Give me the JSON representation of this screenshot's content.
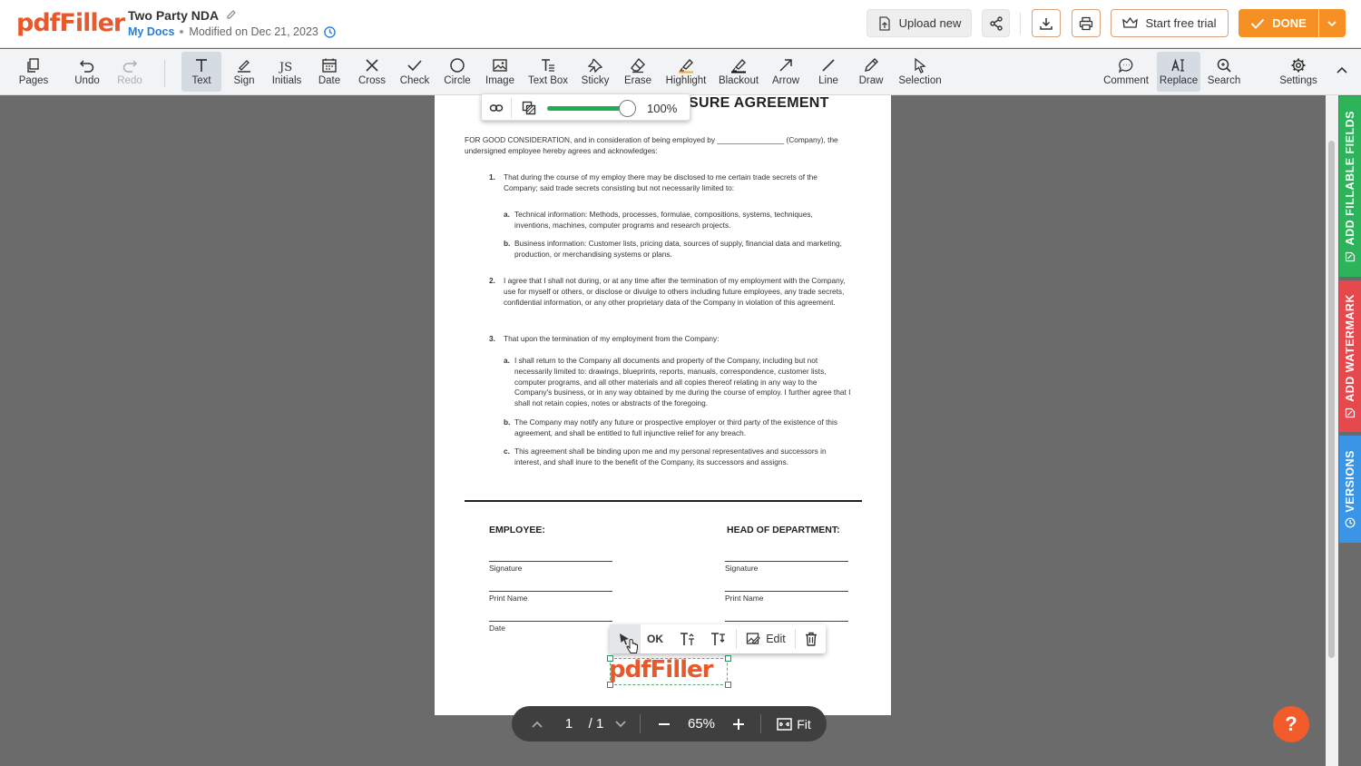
{
  "header": {
    "logo": "pdfFiller",
    "doc_title": "Two Party NDA",
    "breadcrumb": "My Docs",
    "modified": "Modified on Dec 21, 2023",
    "upload_label": "Upload new",
    "trial_label": "Start free trial",
    "done_label": "DONE"
  },
  "toolbar": {
    "tools": [
      {
        "label": "Pages",
        "icon": "pages-icon"
      },
      {
        "label": "Undo",
        "icon": "undo-icon"
      },
      {
        "label": "Redo",
        "icon": "redo-icon"
      },
      {
        "label": "Text",
        "icon": "text-icon"
      },
      {
        "label": "Sign",
        "icon": "sign-icon"
      },
      {
        "label": "Initials",
        "icon": "initials-icon"
      },
      {
        "label": "Date",
        "icon": "calendar-icon"
      },
      {
        "label": "Cross",
        "icon": "cross-icon"
      },
      {
        "label": "Check",
        "icon": "check-icon"
      },
      {
        "label": "Circle",
        "icon": "circle-icon"
      },
      {
        "label": "Image",
        "icon": "image-icon"
      },
      {
        "label": "Text Box",
        "icon": "text-box-icon"
      },
      {
        "label": "Sticky",
        "icon": "pin-icon"
      },
      {
        "label": "Erase",
        "icon": "eraser-icon"
      },
      {
        "label": "Highlight",
        "icon": "highlighter-icon"
      },
      {
        "label": "Blackout",
        "icon": "blackout-icon"
      },
      {
        "label": "Arrow",
        "icon": "arrow-icon"
      },
      {
        "label": "Line",
        "icon": "line-icon"
      },
      {
        "label": "Draw",
        "icon": "pen-icon"
      },
      {
        "label": "Selection",
        "icon": "cursor-icon"
      }
    ],
    "right_tools": [
      {
        "label": "Comment",
        "icon": "comment-icon"
      },
      {
        "label": "Replace",
        "icon": "replace-icon"
      },
      {
        "label": "Search",
        "icon": "search-icon"
      },
      {
        "label": "Settings",
        "icon": "gear-icon"
      }
    ]
  },
  "opacity_bar": {
    "value": "100%",
    "level": 1.0
  },
  "document": {
    "heading": "SURE AGREEMENT",
    "intro": "FOR GOOD CONSIDERATION, and in consideration of being employed by ________________ (Company), the undersigned employee hereby agrees and acknowledges:",
    "items": [
      {
        "num": "1.",
        "text": "That during the course of my employ there may be disclosed to me certain trade secrets of the Company; said trade secrets consisting but not necessarily limited to:"
      },
      {
        "num": "a.",
        "text": "Technical information: Methods, processes, formulae, compositions, systems, techniques, inventions, machines, computer programs and research projects."
      },
      {
        "num": "b.",
        "text": "Business information: Customer lists, pricing data, sources of supply, financial data and marketing, production, or merchandising systems or plans."
      },
      {
        "num": "2.",
        "text": "I agree that I shall not during, or at any time after the termination of my employment with the Company, use for myself or others, or disclose or divulge to others including future employees, any trade secrets, confidential information, or any other proprietary data of the Company in violation of this agreement."
      },
      {
        "num": "3.",
        "text": "That upon the termination of my employment from the Company:"
      },
      {
        "num": "a.",
        "text": "I shall return to the Company all documents and property of the Company, including but not necessarily limited to: drawings, blueprints, reports, manuals, correspondence, customer lists, computer programs, and all other materials and all copies thereof relating in any way to the Company's business, or in any way obtained by me during the course of employ. I further agree that I shall not retain copies, notes or abstracts of the foregoing."
      },
      {
        "num": "b.",
        "text": "The Company may notify any future or prospective employer or third party of the existence of this agreement, and shall be entitled to full injunctive relief for any breach."
      },
      {
        "num": "c.",
        "text": "This agreement shall be binding upon me and my personal representatives and successors in interest, and shall inure to the benefit of the Company, its successors and assigns."
      }
    ],
    "employee_label": "EMPLOYEE:",
    "head_label": "HEAD OF DEPARTMENT:",
    "signature": "Signature",
    "print_name": "Print Name",
    "date": "Date",
    "stamp_text": "pdfFiller"
  },
  "element_toolbar": {
    "ok": "OK",
    "edit": "Edit"
  },
  "bottom_nav": {
    "page": "1",
    "total": "/ 1",
    "zoom": "65%",
    "fit": "Fit"
  },
  "right_tabs": {
    "fillable": "ADD FILLABLE FIELDS",
    "watermark": "ADD WATERMARK",
    "versions": "VERSIONS"
  },
  "colors": {
    "brand": "#e9582a",
    "done": "#f79024",
    "fillable_tab": "#2db35a",
    "watermark_tab": "#e5484d",
    "versions_tab": "#3a95e6"
  }
}
